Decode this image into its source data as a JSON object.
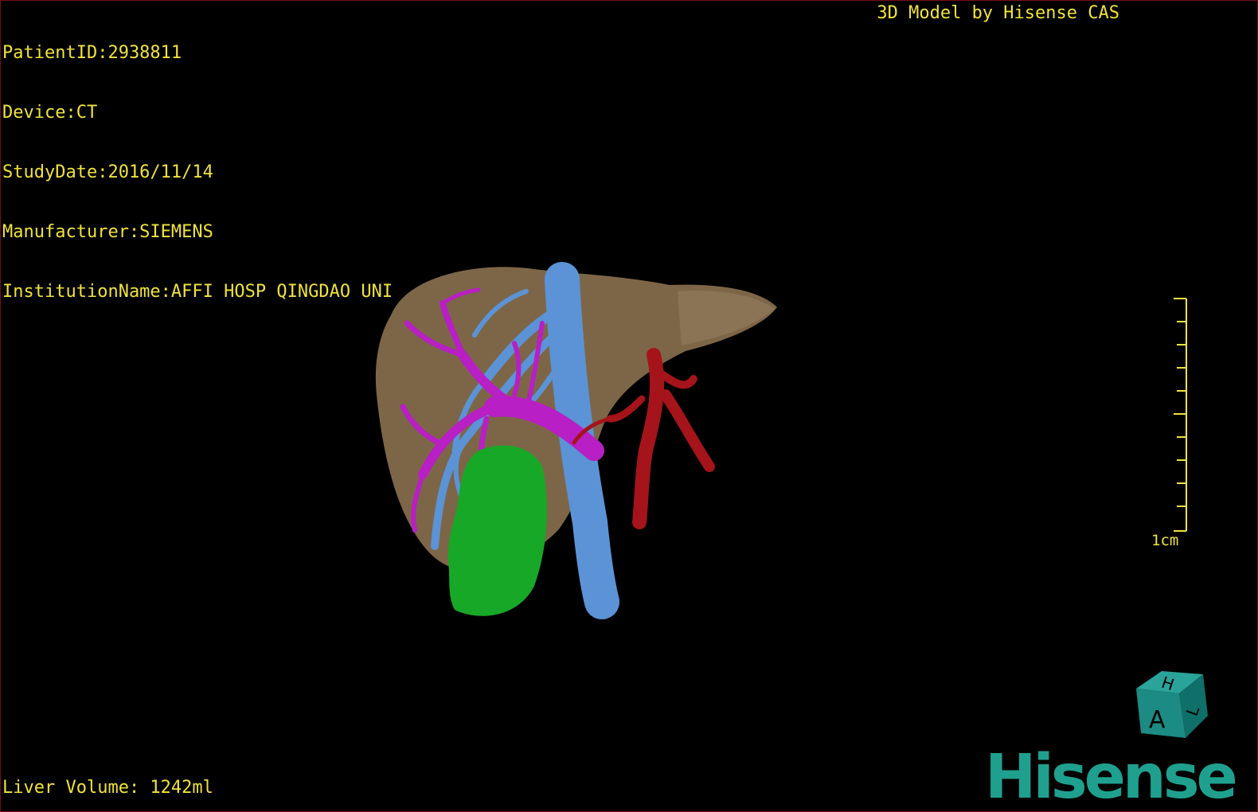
{
  "study": {
    "patient_id_line": "PatientID:2938811",
    "device_line": "Device:CT",
    "study_date_line": "StudyDate:2016/11/14",
    "manufacturer_line": "Manufacturer:SIEMENS",
    "institution_line": "InstitutionName:AFFI HOSP QINGDAO UNI"
  },
  "credit": "3D Model by Hisense CAS",
  "measurements": {
    "liver_volume": "Liver Volume: 1242ml"
  },
  "scale": {
    "label": "1cm"
  },
  "orientation_cube": {
    "front_label": "A",
    "top_label": "H",
    "side_label": "L"
  },
  "brand": "Hisense",
  "colors": {
    "overlay_text": "#f0e33a",
    "liver": "#7d6647",
    "portal_vein": "#b81fc4",
    "hepatic_vein": "#5b93d6",
    "arteries": "#a4141a",
    "tumor": "#17a827",
    "brand": "#1fa08f",
    "frame": "#7a0d12"
  }
}
